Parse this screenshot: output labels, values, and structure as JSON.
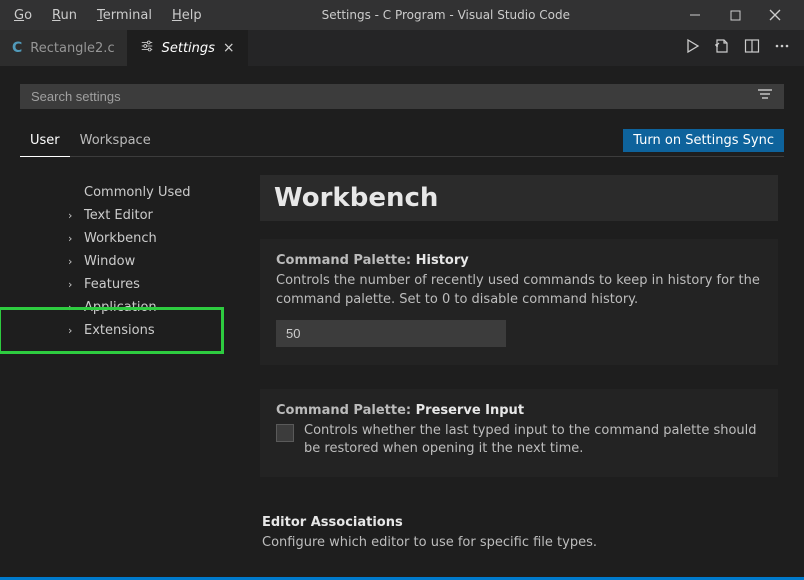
{
  "titlebar": {
    "menu": {
      "go": "Go",
      "run": "Run",
      "terminal": "Terminal",
      "help": "Help"
    },
    "title": "Settings - C Program - Visual Studio Code"
  },
  "tabs": {
    "file": {
      "icon": "C",
      "label": "Rectangle2.c"
    },
    "settings": {
      "label": "Settings"
    }
  },
  "search": {
    "placeholder": "Search settings"
  },
  "scope": {
    "user": "User",
    "workspace": "Workspace",
    "sync_button": "Turn on Settings Sync"
  },
  "tree": {
    "commonly_used": "Commonly Used",
    "text_editor": "Text Editor",
    "workbench": "Workbench",
    "window": "Window",
    "features": "Features",
    "application": "Application",
    "extensions": "Extensions"
  },
  "settings": {
    "section_title": "Workbench",
    "cmd_history": {
      "prefix": "Command Palette: ",
      "name": "History",
      "desc": "Controls the number of recently used commands to keep in history for the command palette. Set to 0 to disable command history.",
      "value": "50"
    },
    "preserve_input": {
      "prefix": "Command Palette: ",
      "name": "Preserve Input",
      "desc": "Controls whether the last typed input to the command palette should be restored when opening it the next time."
    },
    "editor_assoc": {
      "name": "Editor Associations",
      "desc": "Configure which editor to use for specific file types."
    }
  }
}
